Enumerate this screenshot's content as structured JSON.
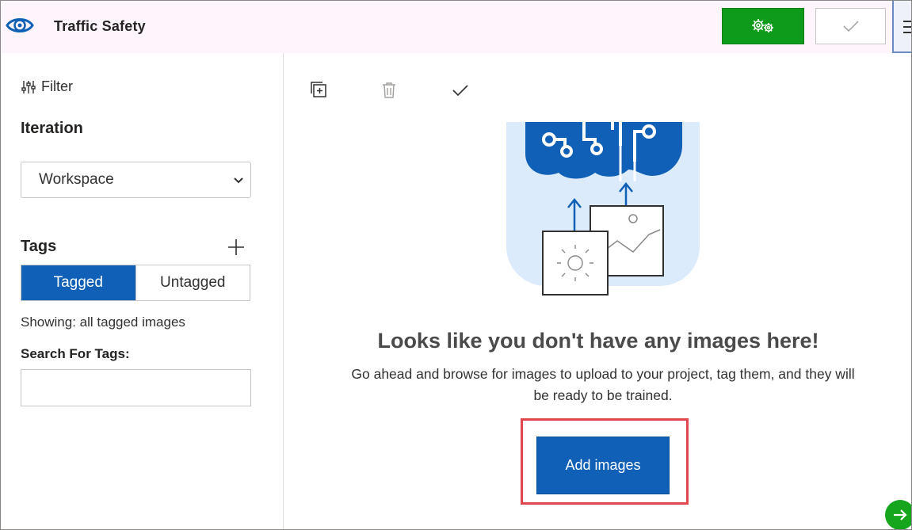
{
  "header": {
    "app_title": "Traffic Safety",
    "logo_icon": "eye-icon",
    "train_icon": "gears-icon",
    "quick_test_icon": "checkmark-icon",
    "menu_icon": "hamburger-icon"
  },
  "sidebar": {
    "filter_label": "Filter",
    "filter_icon": "sliders-icon",
    "iteration_label": "Iteration",
    "iteration_selected": "Workspace",
    "tags_label": "Tags",
    "add_tag_icon": "plus-icon",
    "tag_tabs": [
      {
        "label": "Tagged",
        "active": true
      },
      {
        "label": "Untagged",
        "active": false
      }
    ],
    "showing_text": "Showing: all tagged images",
    "search_label": "Search For Tags:",
    "search_value": ""
  },
  "toolbar": {
    "icons": [
      "select-multiple-icon",
      "trash-icon",
      "checkmark-icon"
    ]
  },
  "empty_state": {
    "title": "Looks like you don't have any images here!",
    "description": "Go ahead and browse for images to upload to your project, tag them, and they will be ready to be trained.",
    "add_button_label": "Add images"
  },
  "colors": {
    "primary_blue": "#0f60b6",
    "train_green": "#0e9a1a",
    "highlight_red": "#e0474c",
    "illustration_bg": "#dcebfc"
  }
}
